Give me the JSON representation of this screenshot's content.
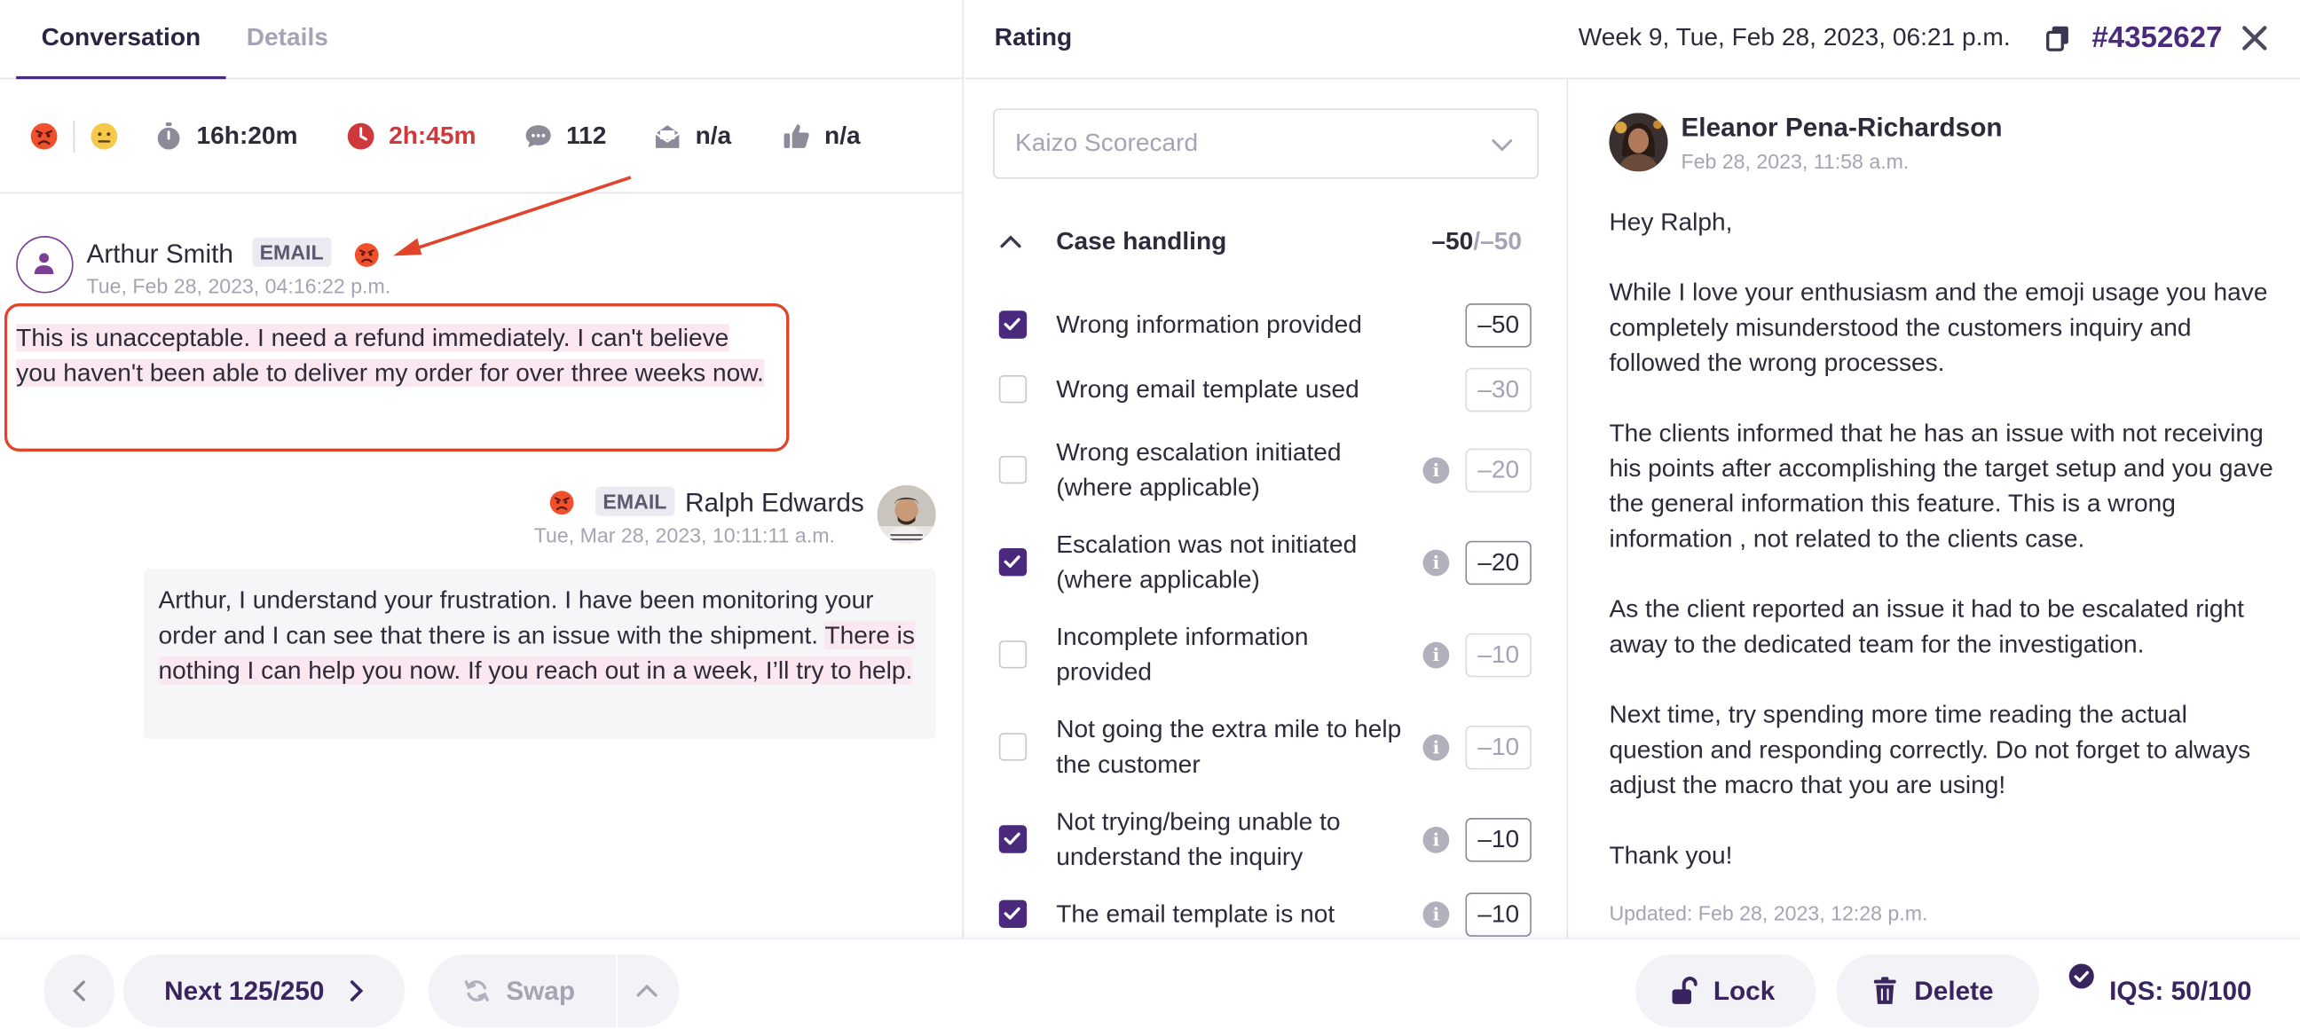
{
  "tabs": {
    "conversation": "Conversation",
    "details": "Details"
  },
  "rating_header": {
    "title": "Rating",
    "date": "Week 9, Tue, Feb 28, 2023, 06:21 p.m.",
    "ticket_id": "#4352627"
  },
  "stats": {
    "handle_time": "16h:20m",
    "resolution_time": "2h:45m",
    "messages": "112",
    "csat": "n/a",
    "rating": "n/a"
  },
  "messages": [
    {
      "author": "Arthur Smith",
      "channel": "EMAIL",
      "time": "Tue, Feb 28, 2023, 04:16:22 p.m.",
      "text": "This is unacceptable. I need a refund immediately. I can't believe you haven't been able to deliver my order for over three weeks now."
    },
    {
      "author": "Ralph Edwards",
      "channel": "EMAIL",
      "time": "Tue, Mar 28, 2023, 10:11:11 a.m.",
      "text_plain": "Arthur, I understand your frustration. I have been monitoring your order and I can see that there is an issue with the shipment.",
      "text_highlight": "There is nothing I can help you now. If you reach out in a week, I’ll try to help."
    }
  ],
  "scorecard": {
    "selected": "Kaizo Scorecard",
    "section": {
      "title": "Case handling",
      "score": "–50",
      "total": "/–50"
    },
    "criteria": [
      {
        "label": "Wrong information provided",
        "points": "–50",
        "checked": true
      },
      {
        "label": "Wrong email template used",
        "points": "–30",
        "checked": false
      },
      {
        "label": "Wrong escalation initiated (where applicable)",
        "points": "–20",
        "checked": false
      },
      {
        "label": "Escalation was not initiated (where applicable)",
        "points": "–20",
        "checked": true
      },
      {
        "label": "Incomplete information provided",
        "points": "–10",
        "checked": false
      },
      {
        "label": "Not going the extra mile to help the customer",
        "points": "–10",
        "checked": false
      },
      {
        "label": "Not trying/being unable to understand the inquiry",
        "points": "–10",
        "checked": true
      },
      {
        "label": "The email template is not",
        "points": "–10",
        "checked": true
      }
    ]
  },
  "feedback": {
    "author": "Eleanor Pena-Richardson",
    "time": "Feb 28, 2023, 11:58 a.m.",
    "paragraphs": [
      "Hey Ralph,",
      "While I love your enthusiasm and the emoji usage you have completely misunderstood the customers inquiry and followed the wrong processes.",
      "The clients informed that he has an issue with not receiving his points after accomplishing the target setup and you gave the general information this feature. This is a wrong information , not related to the clients case.",
      "As the client reported an issue it had to be escalated right away to the dedicated team for the investigation.",
      "Next time, try spending more time reading the actual question and responding correctly. Do not forget to always adjust the macro that you are using!",
      "Thank you!"
    ],
    "updated": "Updated: Feb 28, 2023, 12:28 p.m."
  },
  "footer": {
    "next": "Next 125/250",
    "swap": "Swap",
    "lock": "Lock",
    "delete": "Delete",
    "iqs": "IQS: 50/100"
  },
  "colors": {
    "brand": "#4a2a7d",
    "alert": "#d0393b",
    "highlight": "#fbe7ef",
    "annotation": "#e0442b"
  }
}
